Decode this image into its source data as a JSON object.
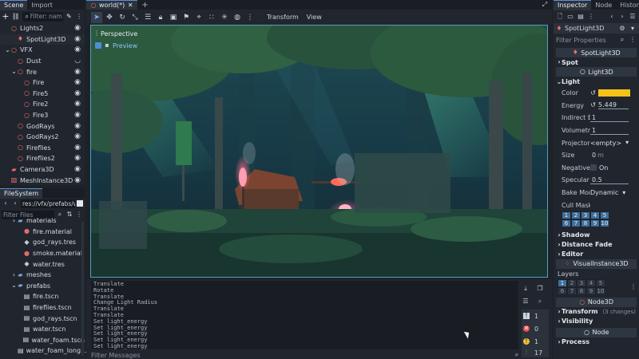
{
  "scene_dock": {
    "tabs": [
      "Scene",
      "Import"
    ],
    "filter_placeholder": "Filter: nam",
    "tree": [
      {
        "label": "Lights2",
        "indent": 0,
        "icon": "node3d-icon",
        "eye": true
      },
      {
        "label": "SpotLight3D",
        "indent": 1,
        "icon": "spotlight-icon",
        "eye": true
      },
      {
        "label": "VFX",
        "indent": 0,
        "icon": "node3d-icon",
        "eye": true
      },
      {
        "label": "Dust",
        "indent": 1,
        "icon": "particles-icon",
        "eye": false
      },
      {
        "label": "fire",
        "indent": 1,
        "icon": "node3d-icon",
        "eye": true
      },
      {
        "label": "Fire",
        "indent": 2,
        "icon": "particles-icon",
        "eye": true
      },
      {
        "label": "Fire5",
        "indent": 2,
        "icon": "particles-icon",
        "eye": true
      },
      {
        "label": "Fire2",
        "indent": 2,
        "icon": "particles-icon",
        "eye": true
      },
      {
        "label": "Fire3",
        "indent": 2,
        "icon": "particles-icon",
        "eye": true
      },
      {
        "label": "GodRays",
        "indent": 1,
        "icon": "particles-icon",
        "eye": true
      },
      {
        "label": "GodRays2",
        "indent": 1,
        "icon": "particles-icon",
        "eye": true
      },
      {
        "label": "Fireflies",
        "indent": 1,
        "icon": "particles-icon",
        "eye": true
      },
      {
        "label": "Fireflies2",
        "indent": 1,
        "icon": "particles-icon",
        "eye": true
      },
      {
        "label": "Camera3D",
        "indent": 0,
        "icon": "camera-icon",
        "eye": true
      },
      {
        "label": "MeshInstance3D",
        "indent": 0,
        "icon": "mesh-icon",
        "eye": true
      }
    ]
  },
  "filesystem": {
    "tab": "FileSystem",
    "path": "res://vfx/prefabs/wind",
    "filter_placeholder": "Filter Files",
    "items": [
      {
        "label": "materials",
        "indent": 1,
        "icon": "folder-icon"
      },
      {
        "label": "fire.material",
        "indent": 2,
        "icon": "material-icon"
      },
      {
        "label": "god_rays.tres",
        "indent": 2,
        "icon": "resource-icon"
      },
      {
        "label": "smoke.material",
        "indent": 2,
        "icon": "material-icon"
      },
      {
        "label": "water.tres",
        "indent": 2,
        "icon": "resource-icon"
      },
      {
        "label": "meshes",
        "indent": 1,
        "icon": "folder-icon"
      },
      {
        "label": "prefabs",
        "indent": 1,
        "icon": "folder-icon"
      },
      {
        "label": "fire.tscn",
        "indent": 2,
        "icon": "scene-icon"
      },
      {
        "label": "fireflies.tscn",
        "indent": 2,
        "icon": "scene-icon"
      },
      {
        "label": "god_rays.tscn",
        "indent": 2,
        "icon": "scene-icon"
      },
      {
        "label": "water.tscn",
        "indent": 2,
        "icon": "scene-icon"
      },
      {
        "label": "water_foam.tscn",
        "indent": 2,
        "icon": "scene-icon"
      },
      {
        "label": "water_foam_long...",
        "indent": 2,
        "icon": "scene-icon"
      }
    ]
  },
  "editor": {
    "scene_tab": "world(*)",
    "add_tab": "+",
    "toolbar_menus": [
      "Transform",
      "View"
    ],
    "viewport_label": "Perspective",
    "preview_label": "Preview"
  },
  "output": {
    "lines": [
      "Translate",
      "Rotate",
      "Translate",
      "Change Light Radius",
      "Translate",
      "Translate",
      "Set light_energy",
      "Set light_energy",
      "Set light_energy",
      "Set light_energy",
      "Set light_energy"
    ],
    "filter_placeholder": "Filter Messages",
    "counts": {
      "log": "1",
      "errors": "0",
      "warnings": "1",
      "info": "17"
    }
  },
  "inspector": {
    "tabs": [
      "Inspector",
      "Node",
      "History"
    ],
    "object_name": "SpotLight3D",
    "filter_placeholder": "Filter Properties",
    "class_header": "SpotLight3D",
    "spot_section": "Spot",
    "light3d_header": "Light3D",
    "light_section": "Light",
    "color_label": "Color",
    "color_value": "#f2c21a",
    "energy_label": "Energy",
    "energy_value": "5.449",
    "indirect_label": "Indirect En...",
    "indirect_value": "1",
    "volumetric_label": "Volumetric...",
    "volumetric_value": "1",
    "projector_label": "Projector",
    "projector_value": "<empty>",
    "size_label": "Size",
    "size_value": "0",
    "size_unit": "m",
    "negative_label": "Negative",
    "negative_value": "On",
    "specular_label": "Specular",
    "specular_value": "0.5",
    "bake_label": "Bake Mode",
    "bake_value": "Dynamic",
    "cull_label": "Cull Mask",
    "cull_grid": [
      "1",
      "2",
      "3",
      "4",
      "5",
      "6",
      "7",
      "8",
      "9",
      "10"
    ],
    "shadow_section": "Shadow",
    "distance_section": "Distance Fade",
    "editor_section": "Editor",
    "visual_header": "VisualInstance3D",
    "layers_label": "Layers",
    "layers_grid": [
      "1",
      "2",
      "3",
      "4",
      "5",
      "6",
      "7",
      "8",
      "9",
      "10"
    ],
    "node3d_header": "Node3D",
    "transform_section": "Transform",
    "transform_changes": "(3 changes)",
    "visibility_section": "Visibility",
    "node_header": "Node",
    "process_section": "Process"
  }
}
